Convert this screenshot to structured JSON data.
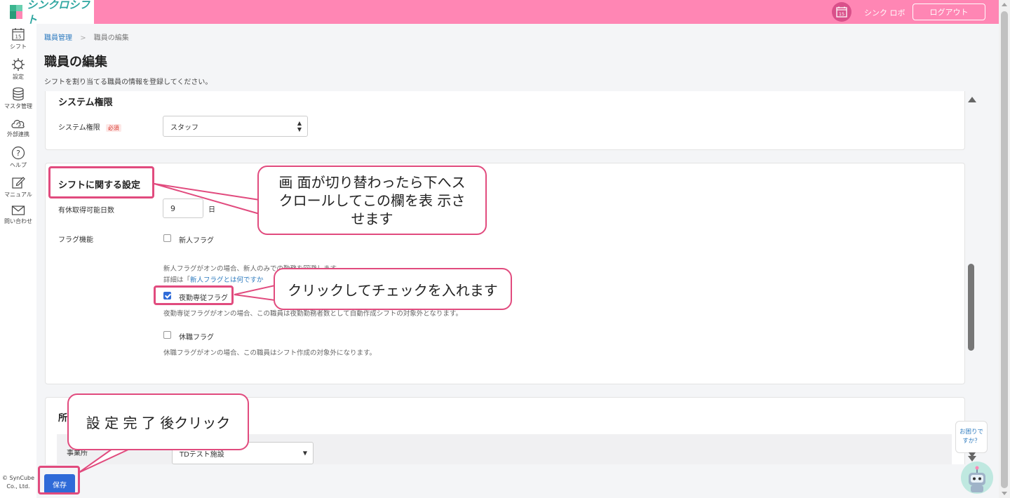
{
  "header": {
    "logo_text": "シンクロシフト",
    "calendar_day": "15",
    "user_name": "シンク ロボ",
    "logout_label": "ログアウト"
  },
  "sidebar": {
    "items": [
      {
        "label": "シフト",
        "icon": "calendar-icon",
        "day": "15"
      },
      {
        "label": "設定",
        "icon": "gear-icon"
      },
      {
        "label": "マスタ管理",
        "icon": "database-icon"
      },
      {
        "label": "外部連携",
        "icon": "cloud-sync-icon"
      },
      {
        "label": "ヘルプ",
        "icon": "question-icon"
      },
      {
        "label": "マニュアル",
        "icon": "edit-icon"
      },
      {
        "label": "問い合わせ",
        "icon": "mail-icon"
      }
    ],
    "copyright_line1": "© SynCube",
    "copyright_line2": "Co., Ltd."
  },
  "breadcrumb": {
    "parent": "職員管理",
    "separator": ">",
    "current": "職員の編集"
  },
  "page": {
    "title": "職員の編集",
    "description": "シフトを割り当てる職員の情報を登録してください。"
  },
  "system_section": {
    "title": "システム権限",
    "field_label": "システム権限",
    "required_badge": "必須",
    "selected_value": "スタッフ"
  },
  "shift_section": {
    "title": "シフトに関する設定",
    "paid_leave_label": "有休取得可能日数",
    "paid_leave_value": "9",
    "paid_leave_unit": "日",
    "flag_label": "フラグ機能",
    "flags": [
      {
        "label": "新人フラグ",
        "checked": false
      },
      {
        "label": "夜勤専従フラグ",
        "checked": true
      },
      {
        "label": "休職フラグ",
        "checked": false
      }
    ],
    "newbie_help_line1": "新人フラグがオンの場合、新人のみでの勤務を回避します。",
    "newbie_help_prefix": "詳細は「",
    "newbie_help_link": "新人フラグとは何ですか",
    "night_help": "夜勤専従フラグがオンの場合、この職員は夜勤勤務者数として自動作成シフトの対象外となります。",
    "leave_help": "休職フラグがオンの場合、この職員はシフト作成の対象外になります。"
  },
  "affiliation_section": {
    "title": "所",
    "row_label": "事業所",
    "selected_value": "TDテスト施設"
  },
  "save_label": "保存",
  "help_widget": {
    "line1": "お困りで",
    "line2": "すか？"
  },
  "annotations": {
    "scroll_note": "画 面が切り替わったら下へス\nクロールしてこの欄を表 示さ\nせます",
    "check_note": "クリックしてチェックを入れます",
    "save_note": "設 定 完 了 後クリック"
  },
  "colors": {
    "brand_pink": "#ff86b4",
    "accent_blue": "#2f6bd8",
    "annotation_pink": "#e14b7e"
  }
}
